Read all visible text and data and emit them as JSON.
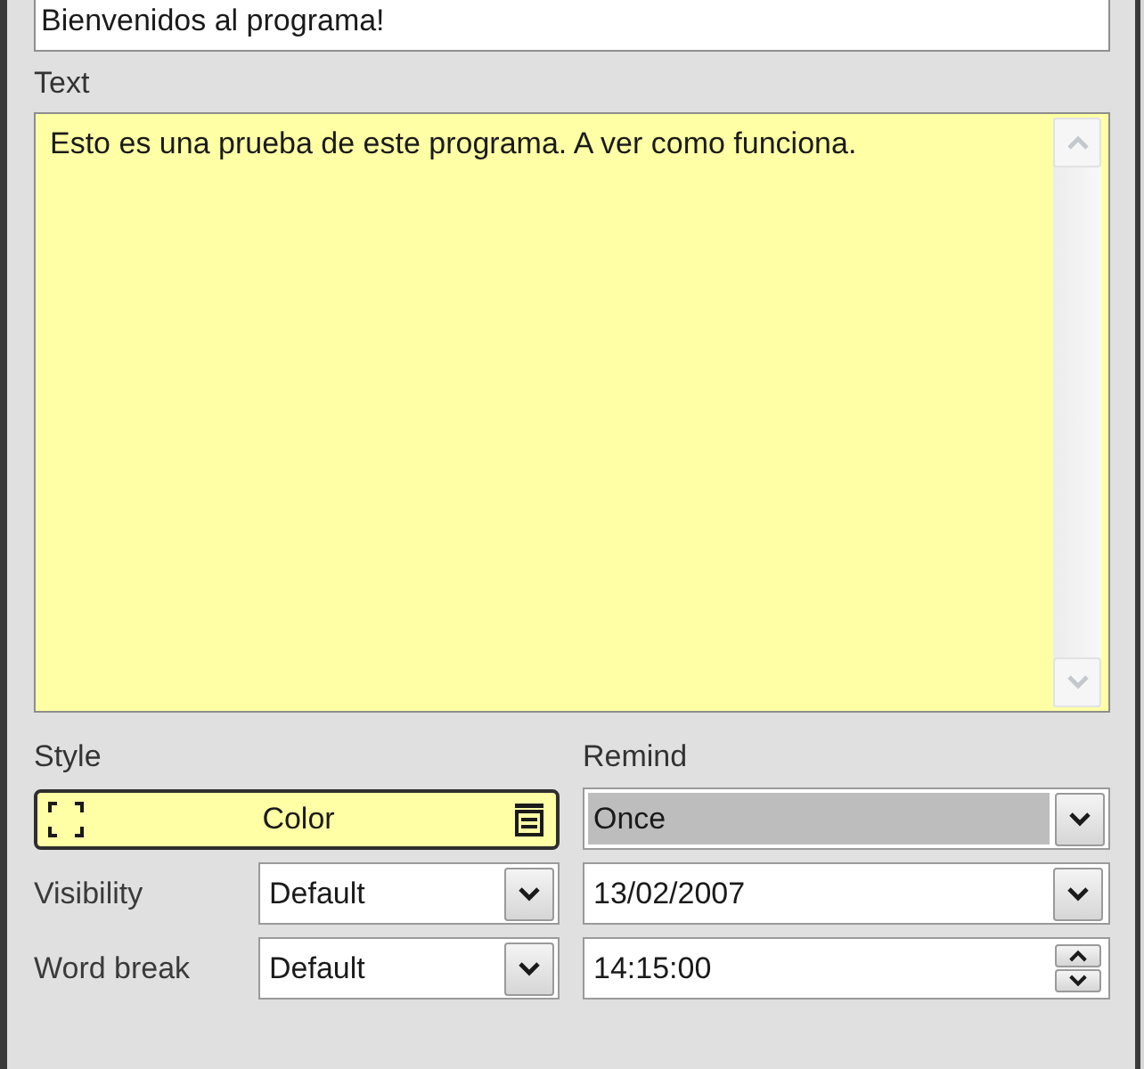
{
  "title_field": {
    "value": "Bienvenidos al programa!"
  },
  "text_section": {
    "label": "Text",
    "value": "Esto es una prueba de este programa. A ver como funciona."
  },
  "style": {
    "label": "Style",
    "button_label": "Color"
  },
  "remind": {
    "label": "Remind",
    "value": "Once",
    "highlighted": true
  },
  "left_fields": [
    {
      "label": "Visibility",
      "value": "Default"
    },
    {
      "label": "Word break",
      "value": "Default"
    }
  ],
  "right_fields": [
    {
      "kind": "date",
      "value": "13/02/2007"
    },
    {
      "kind": "time",
      "value": "14:15:00"
    }
  ]
}
